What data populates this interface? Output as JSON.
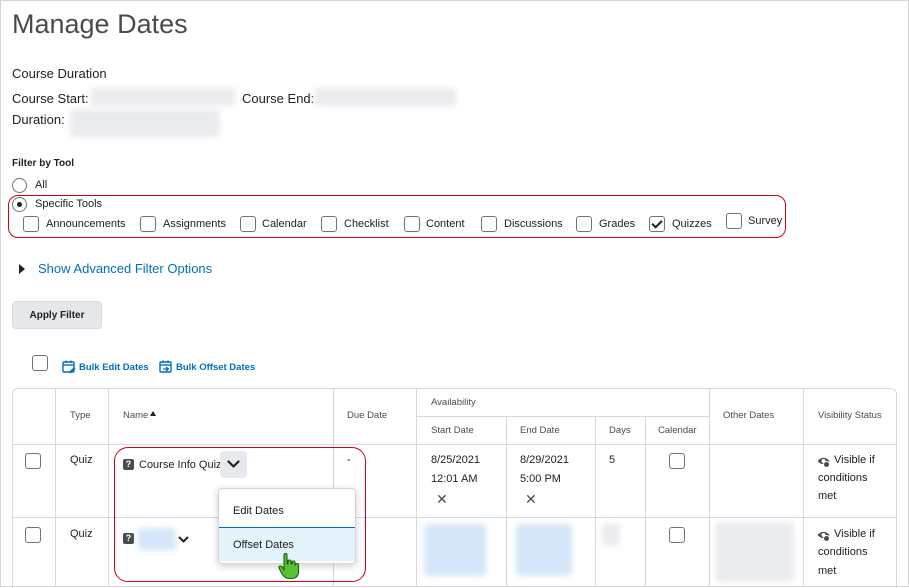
{
  "page": {
    "title": "Manage Dates"
  },
  "course": {
    "heading": "Course Duration",
    "start_label": "Course Start:",
    "end_label": "Course End:",
    "duration_label": "Duration:"
  },
  "filter": {
    "heading": "Filter by Tool",
    "all_label": "All",
    "specific_label": "Specific Tools",
    "tools": [
      {
        "label": "Announcements",
        "checked": false
      },
      {
        "label": "Assignments",
        "checked": false
      },
      {
        "label": "Calendar",
        "checked": false
      },
      {
        "label": "Checklist",
        "checked": false
      },
      {
        "label": "Content",
        "checked": false
      },
      {
        "label": "Discussions",
        "checked": false
      },
      {
        "label": "Grades",
        "checked": false
      },
      {
        "label": "Quizzes",
        "checked": true
      },
      {
        "label": "Survey",
        "checked": false
      }
    ],
    "advanced_link": "Show Advanced Filter Options",
    "apply_label": "Apply Filter"
  },
  "bulk": {
    "edit_label": "Bulk Edit Dates",
    "offset_label": "Bulk Offset Dates"
  },
  "table": {
    "headers": {
      "type": "Type",
      "name": "Name",
      "due": "Due Date",
      "availability": "Availability",
      "start": "Start Date",
      "end": "End Date",
      "days": "Days",
      "calendar": "Calendar",
      "other": "Other Dates",
      "visibility": "Visibility Status"
    },
    "rows": [
      {
        "type": "Quiz",
        "name": "Course Info Quiz",
        "due": "-",
        "start_date": "8/25/2021",
        "start_time": "12:01 AM",
        "end_date": "8/29/2021",
        "end_time": "5:00 PM",
        "days": "5",
        "visibility_1": "Visible if",
        "visibility_2": "conditions",
        "visibility_3": "met"
      },
      {
        "type": "Quiz",
        "visibility_1": "Visible if",
        "visibility_2": "conditions",
        "visibility_3": "met"
      }
    ]
  },
  "menu": {
    "edit_dates": "Edit Dates",
    "offset_dates": "Offset Dates"
  },
  "colors": {
    "link": "#006fbf",
    "highlight": "#d0021b",
    "cursor": "#55c233"
  }
}
